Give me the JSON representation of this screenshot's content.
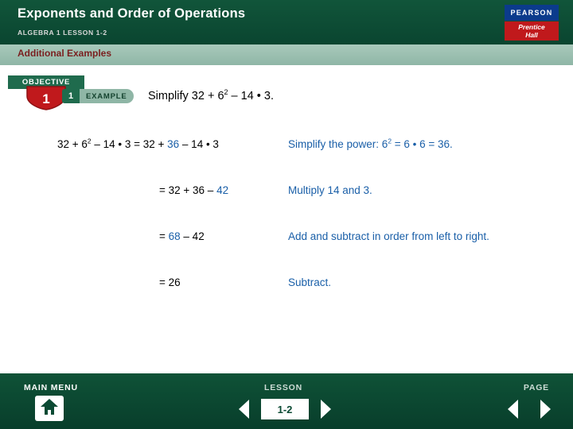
{
  "header": {
    "title": "Exponents and Order of Operations",
    "subtitle": "ALGEBRA 1   LESSON 1-2",
    "logo_pearson": "PEARSON",
    "logo_prentice_line1": "Prentice",
    "logo_prentice_line2": "Hall"
  },
  "subband": {
    "title": "Additional Examples"
  },
  "objective": {
    "label": "OBJECTIVE",
    "number": "1"
  },
  "example": {
    "number": "1",
    "word": "EXAMPLE"
  },
  "problem": {
    "prefix": "Simplify 32 + 6",
    "exponent": "2",
    "suffix": " – 14 • 3."
  },
  "steps": [
    {
      "work_a": "32 + 6",
      "work_exp": "2",
      "work_b": " – 14 • 3 = 32 + ",
      "work_hl": "36",
      "work_c": " – 14 • 3",
      "expl_a": "Simplify the power: 6",
      "expl_exp": "2",
      "expl_b": " = 6 • 6 = 36."
    },
    {
      "work_a": "= 32 + 36 – ",
      "work_hl": "42",
      "work_c": "",
      "expl_a": "Multiply 14 and 3."
    },
    {
      "work_a": "= ",
      "work_hl": "68",
      "work_c": " – 42",
      "expl_a": "Add and subtract in order from left to right."
    },
    {
      "work_a": "= 26",
      "work_hl": "",
      "work_c": "",
      "expl_a": "Subtract."
    }
  ],
  "footer": {
    "main_menu": "MAIN MENU",
    "lesson_label": "LESSON",
    "page_label": "PAGE",
    "lesson_number": "1-2"
  },
  "colors": {
    "header_green": "#0b4a33",
    "band_green": "#9bbfb0",
    "accent_blue": "#1a5fa8",
    "pearson_blue": "#0b3b8c",
    "prentice_red": "#c0191c",
    "maroon_text": "#7a1f1f"
  }
}
